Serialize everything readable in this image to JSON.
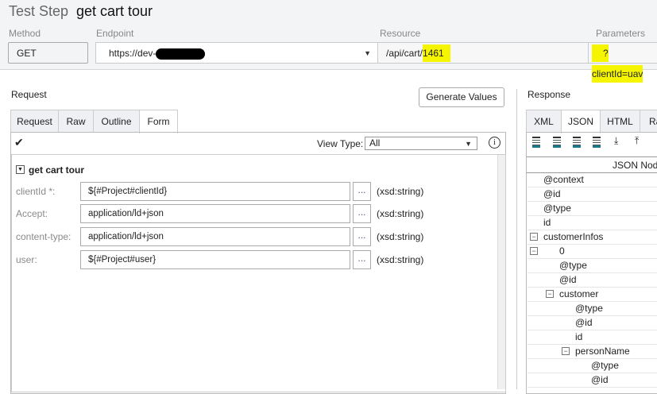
{
  "header": {
    "title_prefix": "Test Step",
    "title": "get cart tour"
  },
  "fields": {
    "method_label": "Method",
    "method": "GET",
    "endpoint_label": "Endpoint",
    "endpoint": "https://dev-",
    "resource_label": "Resource",
    "resource_prefix": "/api/cart/",
    "resource_id": "1461",
    "parameters_label": "Parameters",
    "parameters": "?clientId=uav"
  },
  "request": {
    "label": "Request",
    "generate_values": "Generate Values",
    "tabs": [
      "Request",
      "Raw",
      "Outline",
      "Form"
    ],
    "view_type_label": "View Type:",
    "view_type": "All",
    "form_title": "get cart tour",
    "rows": [
      {
        "label": "clientId *:",
        "value": "${#Project#clientId}",
        "type": "(xsd:string)"
      },
      {
        "label": "Accept:",
        "value": "application/ld+json",
        "type": "(xsd:string)"
      },
      {
        "label": "content-type:",
        "value": "application/ld+json",
        "type": "(xsd:string)"
      },
      {
        "label": "user:",
        "value": "${#Project#user}",
        "type": "(xsd:string)"
      }
    ],
    "dots": "..."
  },
  "response": {
    "label": "Response",
    "tabs": [
      "XML",
      "JSON",
      "HTML",
      "Raw"
    ],
    "column": "JSON Node",
    "nodes": [
      {
        "t": "@context",
        "d": 0,
        "e": false
      },
      {
        "t": "@id",
        "d": 0,
        "e": false
      },
      {
        "t": "@type",
        "d": 0,
        "e": false
      },
      {
        "t": "id",
        "d": 0,
        "e": false
      },
      {
        "t": "customerInfos",
        "d": 0,
        "e": true
      },
      {
        "t": "0",
        "d": 1,
        "e": true
      },
      {
        "t": "@type",
        "d": 2,
        "e": false
      },
      {
        "t": "@id",
        "d": 2,
        "e": false
      },
      {
        "t": "customer",
        "d": 2,
        "e": true
      },
      {
        "t": "@type",
        "d": 3,
        "e": false
      },
      {
        "t": "@id",
        "d": 3,
        "e": false
      },
      {
        "t": "id",
        "d": 3,
        "e": false
      },
      {
        "t": "personName",
        "d": 3,
        "e": true
      },
      {
        "t": "@type",
        "d": 4,
        "e": false
      },
      {
        "t": "@id",
        "d": 4,
        "e": false
      }
    ]
  }
}
